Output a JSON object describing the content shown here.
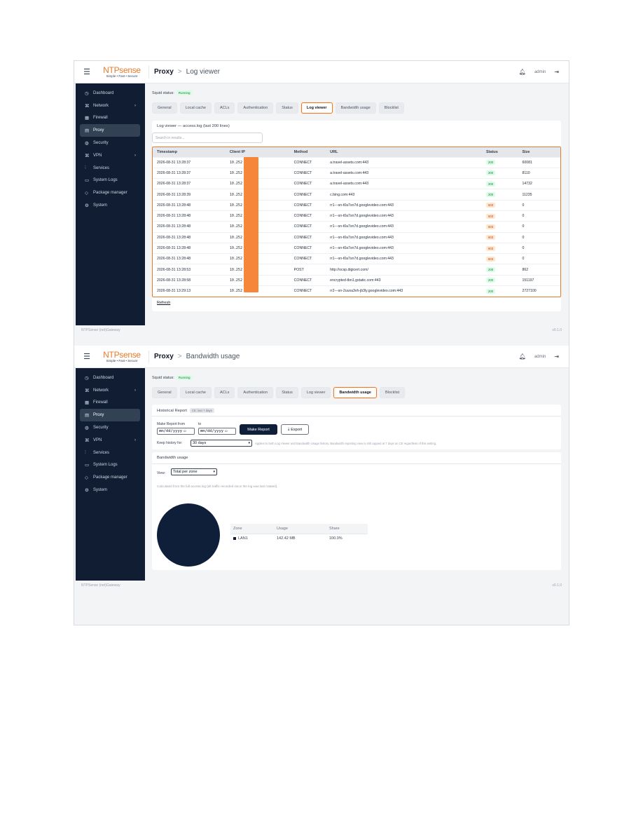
{
  "brand": {
    "name_bold": "NTP",
    "name_light": "sense",
    "tagline": "Simple • Fast • Secure"
  },
  "sidebar": {
    "items": [
      {
        "label": "Dashboard",
        "icon": "dashboard-icon",
        "glyph": "◷"
      },
      {
        "label": "Network",
        "icon": "network-icon",
        "glyph": "⌘",
        "chevron": true
      },
      {
        "label": "Firewall",
        "icon": "firewall-icon",
        "glyph": "▦"
      },
      {
        "label": "Proxy",
        "icon": "proxy-icon",
        "glyph": "▤",
        "active": true
      },
      {
        "label": "Security",
        "icon": "shield-icon",
        "glyph": "◍"
      },
      {
        "label": "VPN",
        "icon": "vpn-icon",
        "glyph": "⌘",
        "chevron": true
      },
      {
        "label": "Services",
        "icon": "services-icon",
        "glyph": "⫶"
      },
      {
        "label": "System Logs",
        "icon": "logs-icon",
        "glyph": "▭"
      },
      {
        "label": "Package manager",
        "icon": "package-icon",
        "glyph": "◇"
      },
      {
        "label": "System",
        "icon": "gear-icon",
        "glyph": "⚙"
      }
    ]
  },
  "user": {
    "name": "admin"
  },
  "footer": {
    "left": "NTPSense (net)Gateway",
    "version": "v0.1.0"
  },
  "tabs": [
    "General",
    "Local cache",
    "ACLs",
    "Authentication",
    "Status",
    "Log viewer",
    "Bandwidth usage",
    "Blocklist"
  ],
  "squid": {
    "label": "Squid status:",
    "value": "Running"
  },
  "screen1": {
    "crumb_root": "Proxy",
    "crumb_sep": ">",
    "crumb_page": "Log viewer",
    "active_tab": "Log viewer",
    "card_title": "Log viewer — access.log (last 200 lines)",
    "search_placeholder": "Search in results...",
    "columns": [
      "Timestamp",
      "Client IP",
      "Method",
      "URL",
      "Status",
      "Size"
    ],
    "rows": [
      [
        "2026-08-31 13:28:37",
        "10.252",
        "CONNECT",
        "a.travel-assets.com:443",
        "200",
        "60081"
      ],
      [
        "2026-08-31 13:28:37",
        "10.252",
        "CONNECT",
        "a.travel-assets.com:443",
        "200",
        "8110"
      ],
      [
        "2026-08-31 13:28:37",
        "10.252",
        "CONNECT",
        "a.travel-assets.com:443",
        "200",
        "14732"
      ],
      [
        "2026-08-31 13:28:39",
        "10.252",
        "CONNECT",
        "c.bing.com:443",
        "200",
        "11235"
      ],
      [
        "2026-08-31 13:28:48",
        "10.252",
        "CONNECT",
        "rr1---sn-t0a7sn7d.googlevideo.com:443",
        "503",
        "0"
      ],
      [
        "2026-08-31 13:28:48",
        "10.252",
        "CONNECT",
        "rr1---sn-t0a7sn7d.googlevideo.com:443",
        "503",
        "0"
      ],
      [
        "2026-08-31 13:28:48",
        "10.252",
        "CONNECT",
        "rr1---sn-t0a7sn7d.googlevideo.com:443",
        "503",
        "0"
      ],
      [
        "2026-08-31 13:28:48",
        "10.252",
        "CONNECT",
        "rr1---sn-t0a7sn7d.googlevideo.com:443",
        "503",
        "0"
      ],
      [
        "2026-08-31 13:28:48",
        "10.252",
        "CONNECT",
        "rr1---sn-t0a7sn7d.googlevideo.com:443",
        "503",
        "0"
      ],
      [
        "2026-08-31 13:28:48",
        "10.252",
        "CONNECT",
        "rr1---sn-t0a7sn7d.googlevideo.com:443",
        "503",
        "0"
      ],
      [
        "2026-08-31 13:28:53",
        "10.252",
        "POST",
        "http://ocsp.digicert.com/",
        "200",
        "862"
      ],
      [
        "2026-08-31 13:28:58",
        "10.252",
        "CONNECT",
        "encrypted-tbn1.gstatic.com:443",
        "200",
        "151197"
      ],
      [
        "2026-08-31 13:29:13",
        "10.252",
        "CONNECT",
        "rr2---sn-2uuxa3vh-jb3ly.googlevideo.com:443",
        "200",
        "2727100"
      ]
    ],
    "refresh_label": "Refresh"
  },
  "screen2": {
    "crumb_root": "Proxy",
    "crumb_sep": ">",
    "crumb_page": "Bandwidth usage",
    "active_tab": "Bandwidth usage",
    "report_title": "Historical Report",
    "report_badge": "CE: last 7 days",
    "from_label": "Make Report from",
    "to_label": "to",
    "date_placeholder": "mm/dd/yyyy",
    "make_report": "Make Report",
    "export": "Export",
    "keep_label": "Keep history for:",
    "keep_value": "30 days",
    "keep_note": "Applies to both Log Viewer and Bandwidth Usage history. Bandwidth reporting view is still capped at 7 days on CE regardless of this setting.",
    "bw_title": "Bandwidth usage",
    "view_label": "View:",
    "view_value": "Total per zone",
    "calc_note": "Calculated from the full access.log (all traffic recorded since the log was last rotated).",
    "zone_columns": [
      "Zone",
      "Usage",
      "Share"
    ],
    "zones": [
      {
        "zone": "LAN1",
        "usage": "142.42 MB",
        "share": "100.0%",
        "share_value": 100,
        "color": "#0f1f3a"
      }
    ]
  },
  "colors": {
    "accent": "#ea7a2b",
    "navy": "#0f1f3a",
    "sidebar": "#111d33"
  }
}
